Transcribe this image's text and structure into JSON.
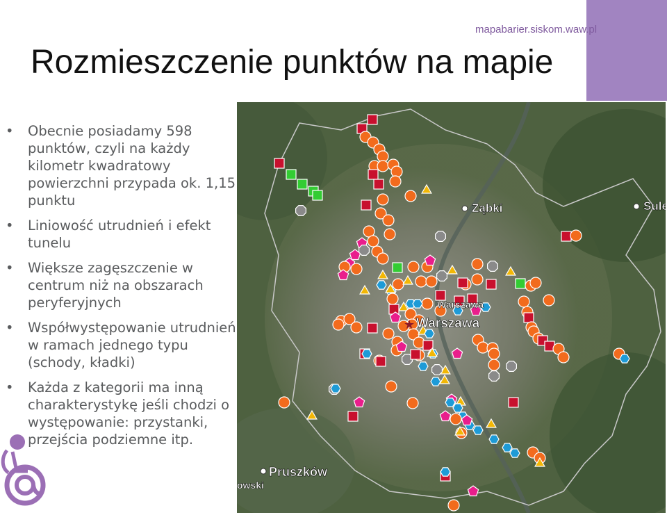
{
  "header": {
    "url": "mapabarier.siskom.waw.pl",
    "title": "Rozmieszczenie punktów na mapie"
  },
  "bullets": [
    "Obecnie posiadamy 598 punktów, czyli na każdy kilometr kwadratowy powierzchni przypada ok. 1,15 punktu",
    "Liniowość utrudnień i efekt tunelu",
    "Większe zagęszczenie w centrum niż na obszarach peryferyjnych",
    "Współwystępowanie utrudnień w ramach jednego typu (schody, kładki)",
    "Każda z kategorii ma inną charakterystykę jeśli chodzi o występowanie: przystanki, przejścia podziemne itp."
  ],
  "map": {
    "labels": {
      "zabki": "Ząbki",
      "sulejowek": "Sule",
      "warszawa_small": "Warszawa",
      "warszawa": "Warszawa",
      "pruszkow": "Pruszków",
      "owski": "owski"
    },
    "marker_colors": {
      "orange_circle": "#f26b1d",
      "red_square": "#c8102e",
      "green_square": "#33cc33",
      "gray_octagon": "#8a8a8a",
      "magenta_pentagon": "#e91e8c",
      "blue_hexagon": "#1e9bd7",
      "yellow_triangle": "#f2b705"
    }
  },
  "logo": {
    "icon": "wheelchair-at-icon",
    "color": "#9b6fb5"
  }
}
